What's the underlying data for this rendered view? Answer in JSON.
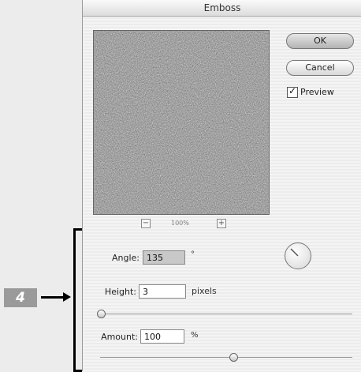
{
  "dialog": {
    "title": "Emboss",
    "buttons": {
      "ok": "OK",
      "cancel": "Cancel"
    },
    "preview": {
      "label": "Preview",
      "checked": true
    },
    "zoom": {
      "level": "100%",
      "minus_icon": "zoom-out-icon",
      "plus_icon": "zoom-in-icon"
    },
    "angle": {
      "label": "Angle:",
      "value": "135",
      "unit": "°"
    },
    "height": {
      "label": "Height:",
      "value": "3",
      "unit": "pixels",
      "slider_fraction": 0.0
    },
    "amount": {
      "label": "Amount:",
      "value": "100",
      "unit": "%",
      "slider_fraction": 0.5
    }
  },
  "annotation": {
    "callout_number": "4"
  }
}
